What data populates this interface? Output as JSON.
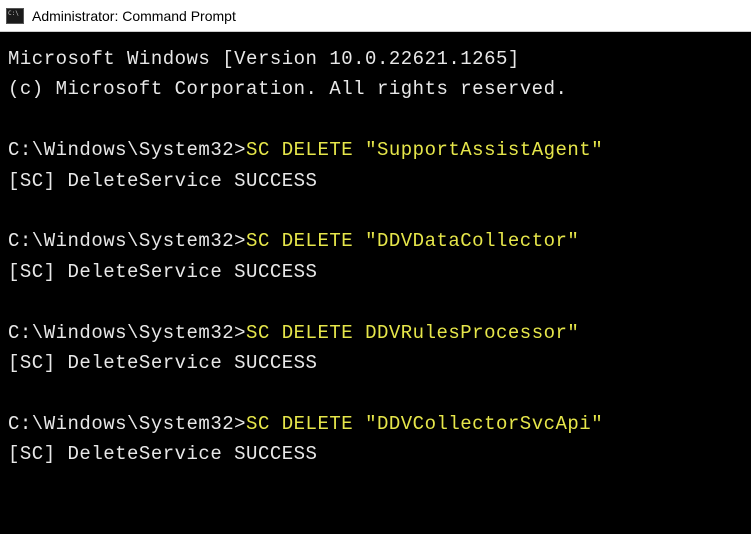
{
  "window": {
    "title": "Administrator: Command Prompt"
  },
  "terminal": {
    "header_line1": "Microsoft Windows [Version 10.0.22621.1265]",
    "header_line2": "(c) Microsoft Corporation. All rights reserved.",
    "prompt": "C:\\Windows\\System32>",
    "entries": [
      {
        "command": "SC DELETE \"SupportAssistAgent\"",
        "result": "[SC] DeleteService SUCCESS"
      },
      {
        "command": "SC DELETE \"DDVDataCollector\"",
        "result": "[SC] DeleteService SUCCESS"
      },
      {
        "command": "SC DELETE DDVRulesProcessor\"",
        "result": "[SC] DeleteService SUCCESS"
      },
      {
        "command": "SC DELETE \"DDVCollectorSvcApi\"",
        "result": "[SC] DeleteService SUCCESS"
      }
    ]
  }
}
